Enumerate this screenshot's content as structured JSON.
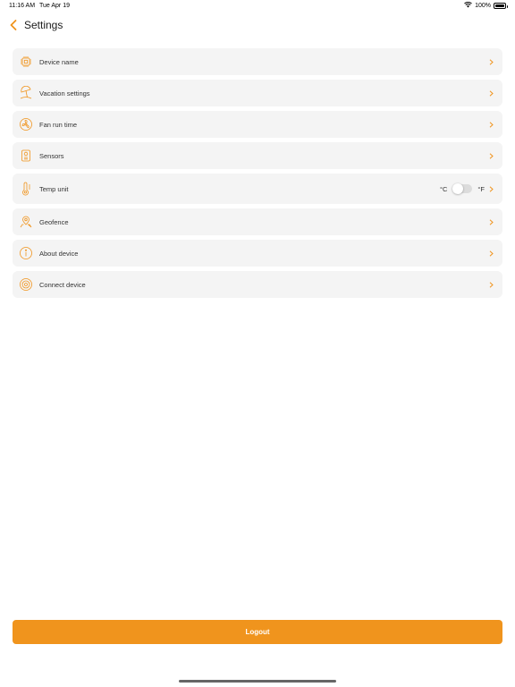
{
  "status_bar": {
    "time": "11:16 AM",
    "date": "Tue Apr 19",
    "battery": "100%",
    "wifi_icon": "wifi-icon",
    "battery_icon": "battery-icon"
  },
  "header": {
    "title": "Settings",
    "back_icon": "chevron-left-icon"
  },
  "settings": {
    "items": [
      {
        "label": "Device name",
        "icon": "chip-icon"
      },
      {
        "label": "Vacation settings",
        "icon": "beach-umbrella-icon"
      },
      {
        "label": "Fan run time",
        "icon": "fan-icon"
      },
      {
        "label": "Sensors",
        "icon": "sensor-icon"
      },
      {
        "label": "Temp unit",
        "icon": "thermometer-icon",
        "unit_c": "°C",
        "unit_f": "°F",
        "toggle_on": false
      },
      {
        "label": "Geofence",
        "icon": "location-pin-icon"
      },
      {
        "label": "About device",
        "icon": "info-icon"
      },
      {
        "label": "Connect device",
        "icon": "connect-icon"
      }
    ]
  },
  "logout_label": "Logout",
  "colors": {
    "accent": "#f0941d",
    "row_background": "#f4f4f4"
  }
}
